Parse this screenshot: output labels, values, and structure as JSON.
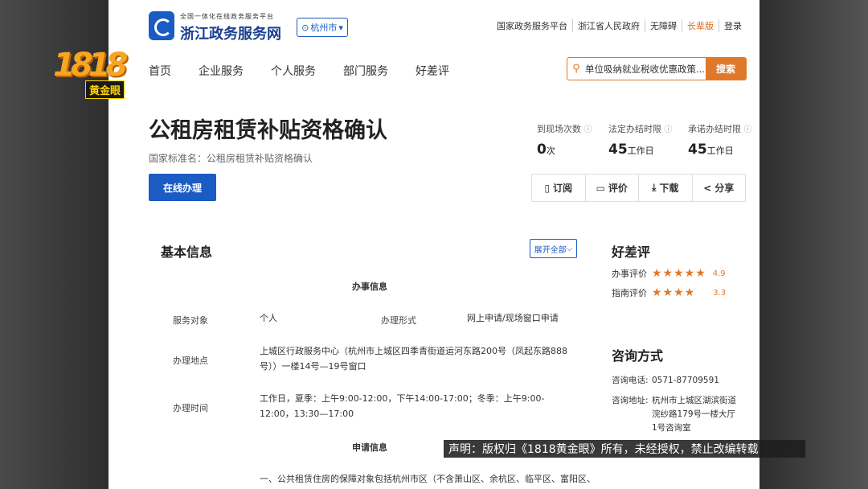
{
  "watermark": {
    "number": "1818",
    "tag": "黄金眼"
  },
  "header": {
    "brand_small": "全国一体化在线政务服务平台",
    "brand_big": "浙江政务服务网",
    "city": "杭州市",
    "top_links": [
      "国家政务服务平台",
      "浙江省人民政府",
      "无障碍",
      "长辈版",
      "登录"
    ]
  },
  "nav": [
    "首页",
    "企业服务",
    "个人服务",
    "部门服务",
    "好差评"
  ],
  "search": {
    "text": "单位吸纳就业税收优惠政策...",
    "button": "搜索"
  },
  "main": {
    "title": "公租房租赁补贴资格确认",
    "standard_name": "国家标准名：公租房租赁补贴资格确认",
    "online_button": "在线办理"
  },
  "stats": [
    {
      "label": "到现场次数",
      "value": "0",
      "unit": "次"
    },
    {
      "label": "法定办结时限",
      "value": "45",
      "unit": "工作日"
    },
    {
      "label": "承诺办结时限",
      "value": "45",
      "unit": "工作日"
    }
  ],
  "actions": [
    "订阅",
    "评价",
    "下载",
    "分享"
  ],
  "basic": {
    "title": "基本信息",
    "expand": "展开全部",
    "section1": "办事信息",
    "service_object_label": "服务对象",
    "service_object_value": "个人",
    "form_label": "办理形式",
    "form_value": "网上申请/现场窗口申请",
    "place_label": "办理地点",
    "place_value": "上城区行政服务中心（杭州市上城区四季青街道运河东路200号（凤起东路888号））一楼14号—19号窗口",
    "time_label": "办理时间",
    "time_value": "工作日，夏季：上午9:00-12:00，下午14:00-17:00；冬季：上午9:00-12:00，13:30—17:00",
    "section2": "申请信息",
    "apply_line": "一、公共租赁住房的保障对象包括杭州市区（不含萧山区、余杭区、临平区、富阳区、"
  },
  "rating": {
    "title": "好差评",
    "items": [
      {
        "label": "办事评价",
        "stars": "★★★★★",
        "score": "4.9"
      },
      {
        "label": "指南评价",
        "stars": "★★★★",
        "score": "3.3"
      }
    ]
  },
  "consult": {
    "title": "咨询方式",
    "phone_label": "咨询电话:",
    "phone": "0571-87709591",
    "addr_label": "咨询地址:",
    "addr": "杭州市上城区湖滨街道浣纱路179号一楼大厅1号咨询室"
  },
  "notice": "声明：版权归《1818黄金眼》所有，未经授权，禁止改编转载"
}
